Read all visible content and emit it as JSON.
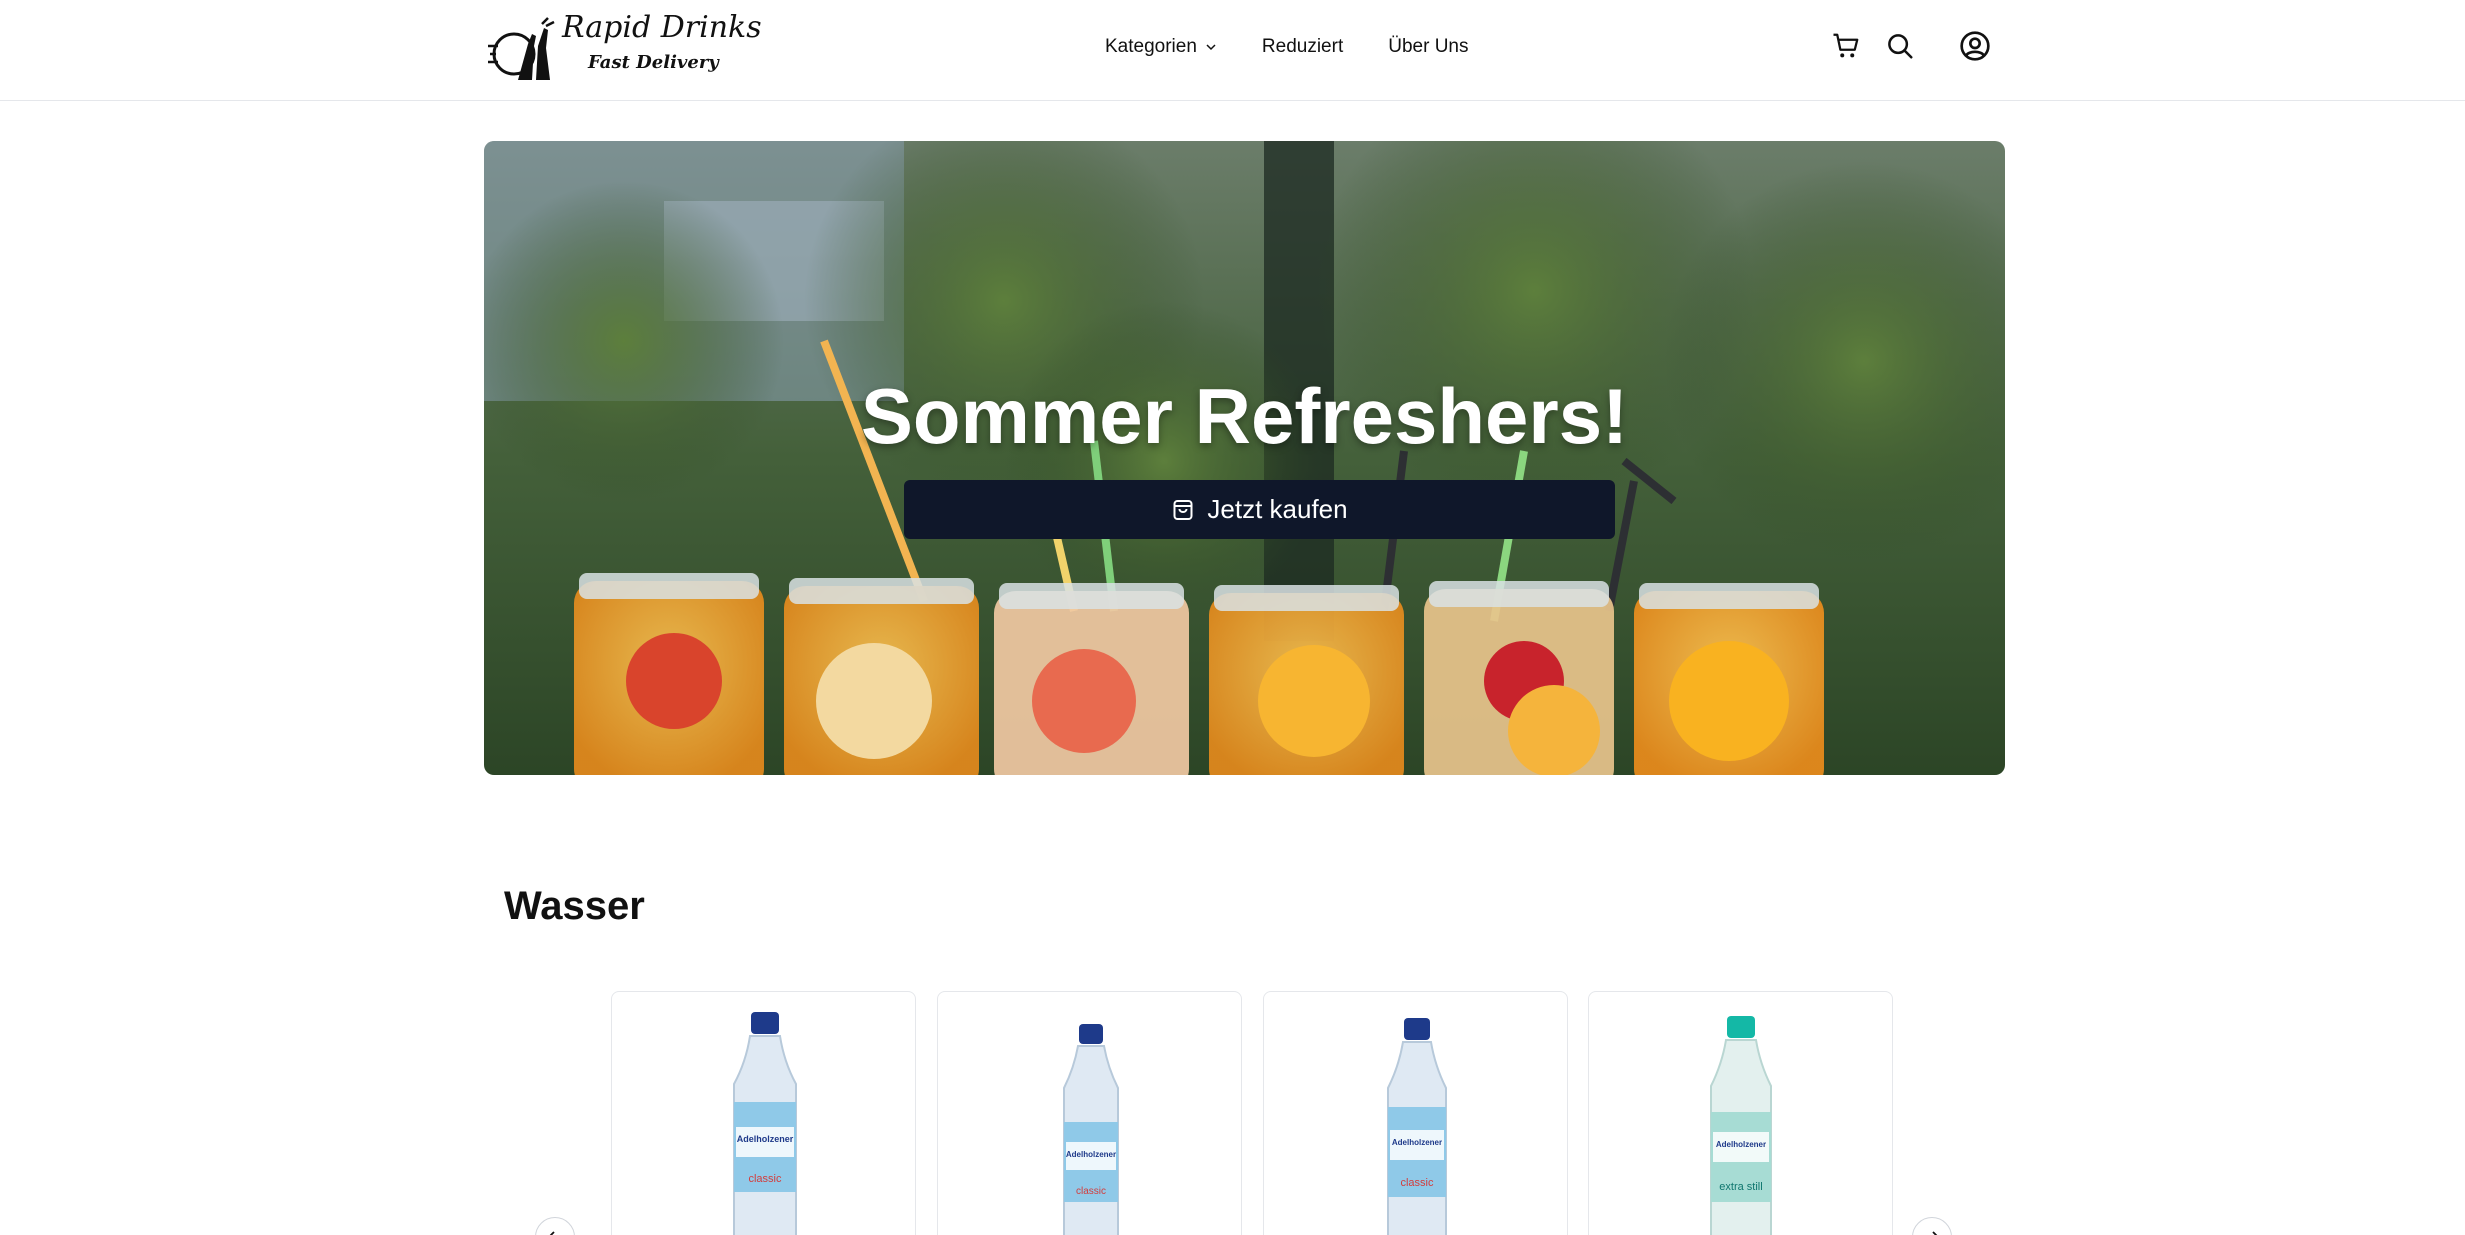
{
  "header": {
    "logo": {
      "line1": "Rapid Drinks",
      "line2": "Fast Delivery"
    },
    "nav": [
      {
        "label": "Kategorien",
        "has_dropdown": true
      },
      {
        "label": "Reduziert"
      },
      {
        "label": "Über Uns"
      }
    ],
    "icons": [
      "cart-icon",
      "search-icon",
      "user-icon"
    ]
  },
  "hero": {
    "title": "Sommer Refreshers!",
    "cta_label": "Jetzt kaufen",
    "cta_icon": "shopping-bag-icon"
  },
  "section": {
    "title": "Wasser",
    "products": [
      {
        "brand": "Adelholzener",
        "variant": "classic",
        "cap_color": "#1e3a8a"
      },
      {
        "brand": "Adelholzener",
        "variant": "classic",
        "cap_color": "#1e3a8a"
      },
      {
        "brand": "Adelholzener",
        "variant": "classic",
        "cap_color": "#1e3a8a"
      },
      {
        "brand": "Adelholzener",
        "variant": "extra still",
        "cap_color": "#14b8a6"
      }
    ],
    "prev_icon": "arrow-left-icon",
    "next_icon": "arrow-right-icon"
  },
  "colors": {
    "cta_bg": "#0f172a",
    "border": "#e5e7eb"
  }
}
